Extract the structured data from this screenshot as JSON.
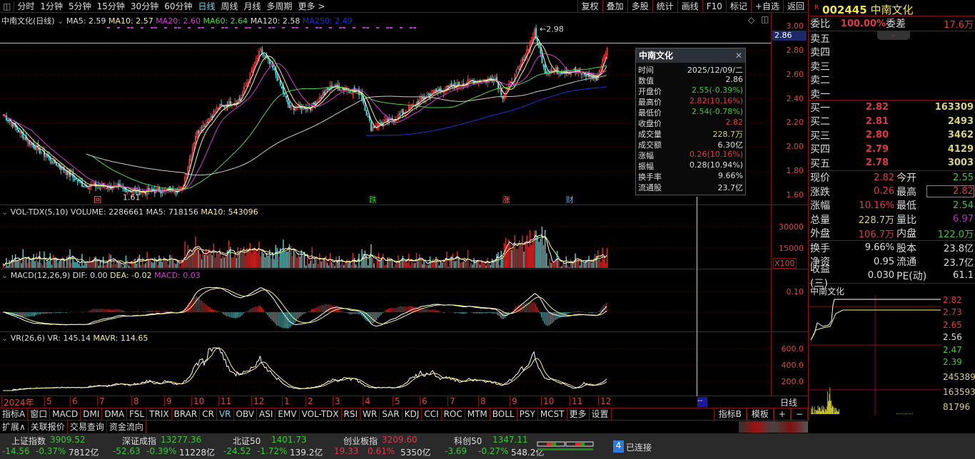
{
  "toolbar": {
    "periods": [
      "分时",
      "1分钟",
      "5分钟",
      "15分钟",
      "30分钟",
      "60分钟",
      "日线",
      "周线",
      "月线",
      "多周期",
      "更多 >"
    ],
    "active": "日线",
    "right": [
      "复权",
      "叠加",
      "多股",
      "统计",
      "画线",
      "F10",
      "标记",
      "+自选",
      "返回"
    ]
  },
  "chart_header": {
    "title": "中南文化(日线)",
    "ma5": "MA5: 2.59",
    "ma10": "MA10: 2.57",
    "ma20": "MA20: 2.60",
    "ma60": "MA60: 2.64",
    "ma120": "MA120: 2.58",
    "ma250": "MA250: 2.49"
  },
  "price_axis": {
    "labels": [
      "3.00",
      "2.80",
      "2.60",
      "2.40",
      "2.20",
      "2.00",
      "1.80",
      "1.60"
    ],
    "current": "2.86",
    "high_mark": "2.98",
    "low_mark": "1.61"
  },
  "events": [
    {
      "label": "回",
      "day": 60
    },
    {
      "label": "跌",
      "day": 242
    },
    {
      "label": "涨",
      "day": 330
    },
    {
      "label": "财",
      "day": 372
    }
  ],
  "volume": {
    "header": "VOL-TDX(5,10)",
    "volume": "VOLUME: 2286661",
    "ma5": "MA5: 718156",
    "ma10": "MA10: 543096",
    "axis": [
      "30000",
      "15000"
    ],
    "unit": "X100"
  },
  "macd": {
    "header": "MACD(12,26,9)",
    "dif": "DIF: 0.00",
    "dea": "DEA: -0.02",
    "macd": "MACD: 0.03",
    "axis": [
      "0.10"
    ]
  },
  "vr": {
    "header": "VR(26,6)",
    "vr": "VR: 145.14",
    "mavr": "MAVR: 114.65",
    "axis": [
      "600.0",
      "400.0",
      "200.0"
    ]
  },
  "date_axis": {
    "labels": [
      "2024年",
      "5",
      "6",
      "7",
      "8",
      "9",
      "10",
      "11",
      "12",
      "1",
      "2",
      "3",
      "4",
      "5",
      "6",
      "7",
      "8",
      "9",
      "10",
      "11",
      "12"
    ],
    "cursor": "--",
    "period": "日线"
  },
  "tooltip": {
    "title": "中南文化",
    "rows": [
      [
        "时间",
        "2025/12/09/二"
      ],
      [
        "数值",
        "2.86"
      ],
      [
        "开盘价",
        "2.55(-0.39%)"
      ],
      [
        "最高价",
        "2.82(10.16%)"
      ],
      [
        "最低价",
        "2.54(-0.78%)"
      ],
      [
        "收盘价",
        "2.82"
      ],
      [
        "成交量",
        "228.7万"
      ],
      [
        "成交额",
        "6.30亿"
      ],
      [
        "涨幅",
        "0.26(10.16%)"
      ],
      [
        "振幅",
        "0.28(10.94%)"
      ],
      [
        "换手率",
        "9.66%"
      ],
      [
        "流通股",
        "23.7亿"
      ]
    ]
  },
  "quote": {
    "code": "002445",
    "name": "中南文化",
    "badge": "R",
    "wb_label": "委比",
    "wb": "100.00%",
    "wc_label": "委差",
    "wc": "17.6万",
    "sells": [
      "卖五",
      "卖四",
      "卖三",
      "卖二",
      "卖一"
    ],
    "buys": [
      [
        "买一",
        "2.82",
        "163309"
      ],
      [
        "买二",
        "2.81",
        "2493"
      ],
      [
        "买三",
        "2.80",
        "3462"
      ],
      [
        "买四",
        "2.79",
        "4129"
      ],
      [
        "买五",
        "2.78",
        "3003"
      ]
    ],
    "stats": [
      [
        "现价",
        "2.82",
        "今开",
        "2.55"
      ],
      [
        "涨跌",
        "0.26",
        "最高",
        "2.82"
      ],
      [
        "涨幅",
        "10.16%",
        "最低",
        "2.54"
      ],
      [
        "总量",
        "228.7万",
        "量比",
        "6.97"
      ],
      [
        "外盘",
        "106.7万",
        "内盘",
        "122.0万"
      ]
    ],
    "stats2": [
      [
        "换手",
        "9.66%",
        "股本",
        "23.8亿"
      ],
      [
        "净资",
        "0.95",
        "流通",
        "23.7亿"
      ],
      [
        "收益(三)",
        "0.030",
        "PE(动)",
        "61.1"
      ]
    ]
  },
  "mini": {
    "title": "中南文化",
    "axis": [
      "2.82",
      "2.73",
      "2.65",
      "2.56",
      "2.47",
      "2.39"
    ],
    "vol_axis": [
      "245389",
      "163593",
      "81796"
    ]
  },
  "tabs": [
    "指标A",
    "窗口",
    "MACD",
    "DMI",
    "DMA",
    "FSL",
    "TRIX",
    "BRAR",
    "CR",
    "VR",
    "OBV",
    "ASI",
    "EMV",
    "VOL-TDX",
    "RSI",
    "WR",
    "SAR",
    "KDJ",
    "CCI",
    "ROC",
    "MTM",
    "BOLL",
    "PSY",
    "MCST",
    "更多",
    "设置"
  ],
  "tabs_right": [
    "指标B",
    "模板",
    "+",
    "−"
  ],
  "tabs2": [
    "扩展∧",
    "关联报价",
    "交易查询",
    "资金流向"
  ],
  "indices": [
    {
      "name": "上证指数",
      "value": "3909.52",
      "chg": "-14.56",
      "pct": "-0.37%",
      "amt": "7812亿",
      "up": false
    },
    {
      "name": "深证成指",
      "value": "13277.36",
      "chg": "-52.63",
      "pct": "-0.39%",
      "amt": "11228亿",
      "up": false
    },
    {
      "name": "北证50",
      "value": "1401.73",
      "chg": "-24.52",
      "pct": "-1.72%",
      "amt": "139.2亿",
      "up": false
    },
    {
      "name": "创业板指",
      "value": "3209.60",
      "chg": "19.33",
      "pct": "0.61%",
      "amt": "5350亿",
      "up": true
    },
    {
      "name": "科创50",
      "value": "1347.11",
      "chg": "-3.69",
      "pct": "-0.27%",
      "amt": "548.2亿",
      "up": false
    }
  ],
  "connection": {
    "count": "4",
    "label": "已连接"
  },
  "chart_data": {
    "type": "candlestick",
    "title": "中南文化(日线)",
    "ylim": [
      1.6,
      3.0
    ],
    "days": 400,
    "price_path": [
      [
        0,
        2.27
      ],
      [
        17,
        2.04
      ],
      [
        38,
        1.83
      ],
      [
        52,
        1.69
      ],
      [
        71,
        1.67
      ],
      [
        90,
        1.63
      ],
      [
        118,
        1.65
      ],
      [
        127,
        2.1
      ],
      [
        142,
        2.33
      ],
      [
        156,
        2.39
      ],
      [
        170,
        2.8
      ],
      [
        179,
        2.63
      ],
      [
        189,
        2.33
      ],
      [
        203,
        2.33
      ],
      [
        217,
        2.51
      ],
      [
        236,
        2.45
      ],
      [
        243,
        2.16
      ],
      [
        259,
        2.24
      ],
      [
        283,
        2.45
      ],
      [
        307,
        2.54
      ],
      [
        325,
        2.57
      ],
      [
        330,
        2.42
      ],
      [
        340,
        2.63
      ],
      [
        351,
        2.95
      ],
      [
        358,
        2.63
      ],
      [
        377,
        2.63
      ],
      [
        392,
        2.57
      ],
      [
        399,
        2.82
      ]
    ]
  }
}
